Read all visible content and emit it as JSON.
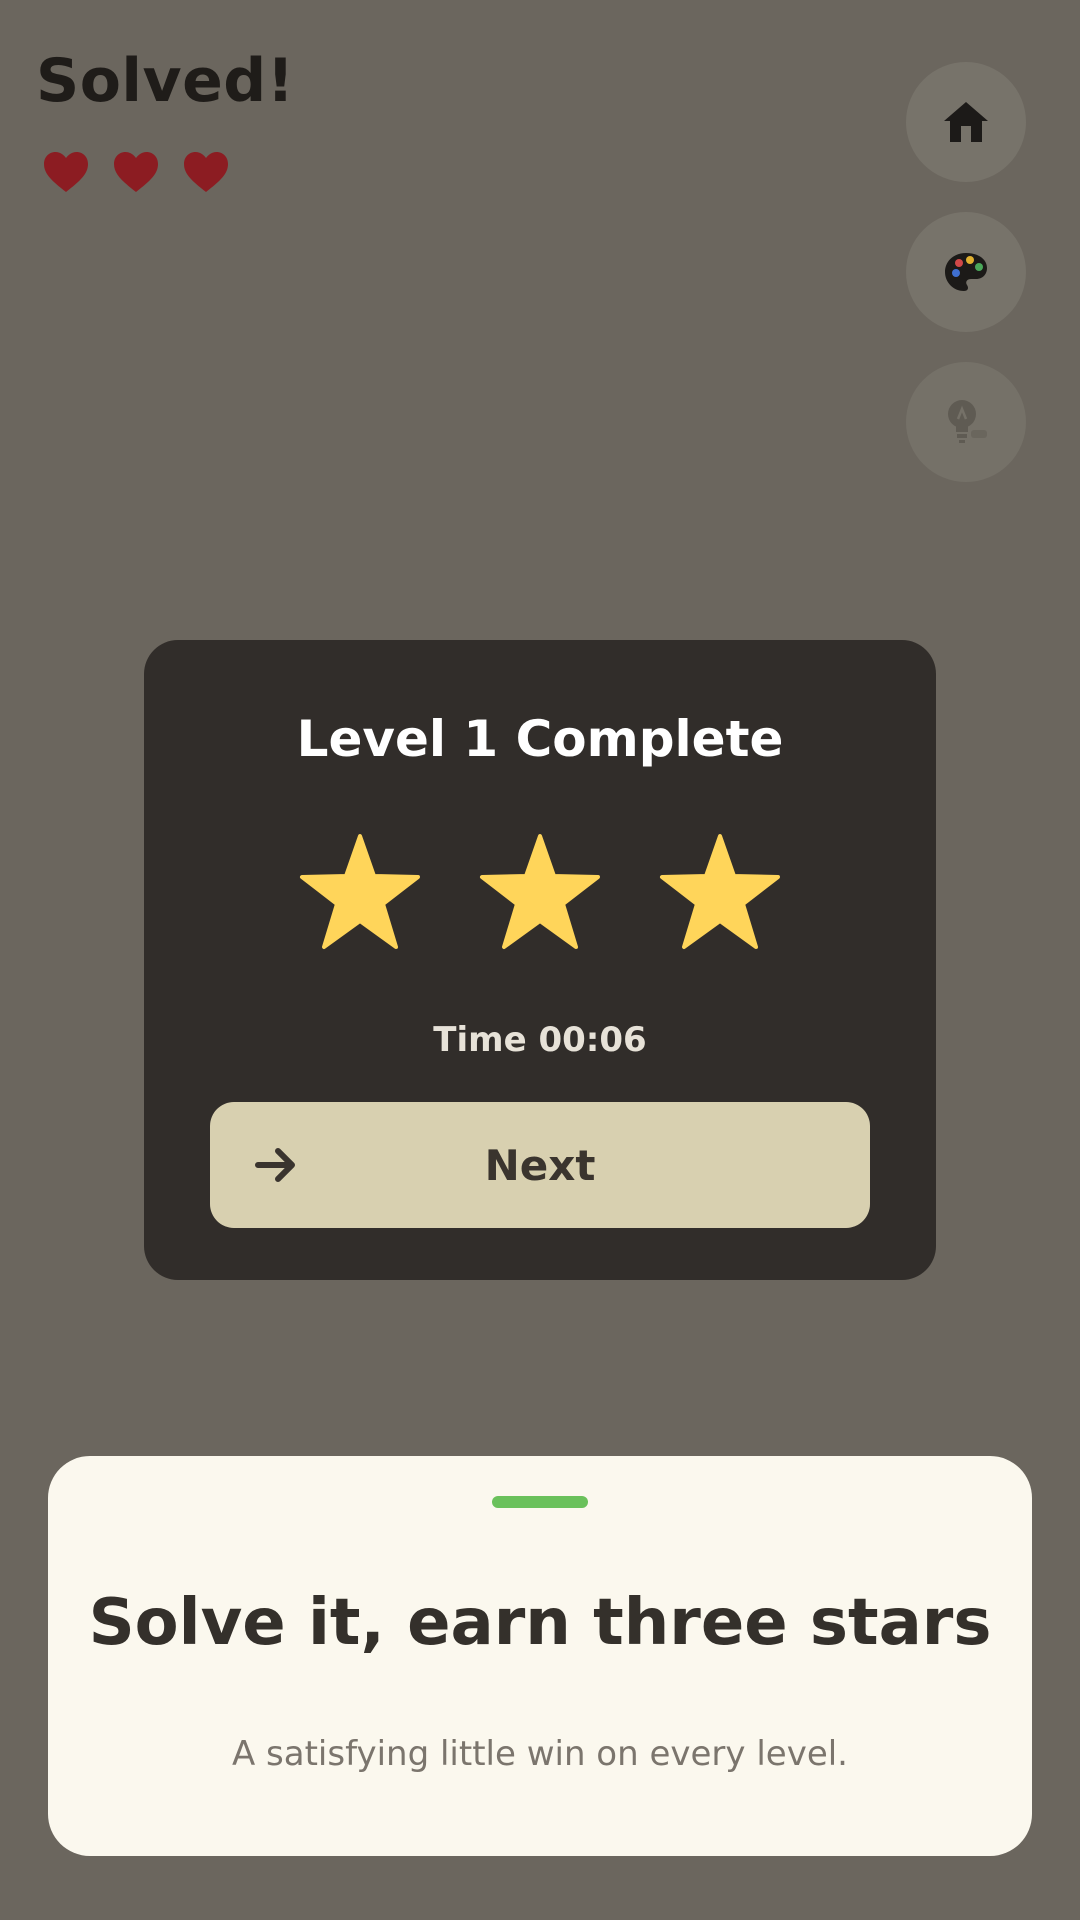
{
  "header": {
    "title": "Solved!",
    "lives": 3,
    "heart_color": "#8c1c22"
  },
  "side_buttons": [
    {
      "icon": "home-icon",
      "enabled": true
    },
    {
      "icon": "palette-icon",
      "enabled": true
    },
    {
      "icon": "lightbulb-icon",
      "enabled": false
    }
  ],
  "modal": {
    "title": "Level 1 Complete",
    "stars_earned": 3,
    "star_color": "#ffd55a",
    "time_text": "Time 00:06",
    "next_label": "Next"
  },
  "sheet": {
    "handle_color": "#6ac15b",
    "title": "Solve it, earn three stars",
    "subtitle": "A satisfying little win on every level."
  }
}
